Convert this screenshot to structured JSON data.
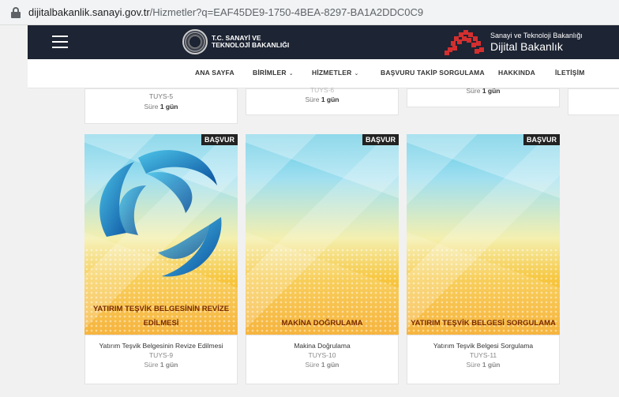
{
  "browser": {
    "url_host": "dijitalbakanlik.sanayi.gov.tr",
    "url_path": "/Hizmetler?q=EAF45DE9-1750-4BEA-8297-BA1A2DDC0C9"
  },
  "header": {
    "ministry_line1": "T.C. SANAYİ VE",
    "ministry_line2": "TEKNOLOJİ BAKANLIĞI",
    "digital_line1": "Sanayi ve Teknoloji Bakanlığı",
    "digital_line2": "Dijital Bakanlık",
    "accent_color": "#d32f2f"
  },
  "nav": {
    "items": [
      "ANA SAYFA",
      "BİRİMLER",
      "HİZMETLER",
      "BAŞVURU TAKİP SORGULAMA",
      "HAKKINDA",
      "İLETİŞİM"
    ]
  },
  "top_cards": [
    {
      "code": "TUYS-5",
      "duration_label": "Süre",
      "duration_value": "1 gün"
    },
    {
      "code": "TUYS-6",
      "duration_label": "Süre",
      "duration_value": "1 gün"
    },
    {
      "duration_label": "Süre",
      "duration_value": "1 gün"
    }
  ],
  "services": [
    {
      "badge": "BAŞVUR",
      "title_line1": "YATIRIM TEŞVİK BELGESİNİN REVİZE",
      "title_line2": "EDİLMESİ",
      "name": "Yatırım Teşvik Belgesinin Revize Edilmesi",
      "code": "TUYS-9",
      "duration_label": "Süre",
      "duration_value": "1 gün"
    },
    {
      "badge": "BAŞVUR",
      "title_line1": "MAKİNA DOĞRULAMA",
      "name": "Makina Doğrulama",
      "code": "TUYS-10",
      "duration_label": "Süre",
      "duration_value": "1 gün"
    },
    {
      "badge": "BAŞVUR",
      "title_line1": "YATIRIM TEŞVİK BELGESİ SORGULAMA",
      "name": "Yatırım Teşvik Belgesi Sorgulama",
      "code": "TUYS-11",
      "duration_label": "Süre",
      "duration_value": "1 gün"
    }
  ]
}
